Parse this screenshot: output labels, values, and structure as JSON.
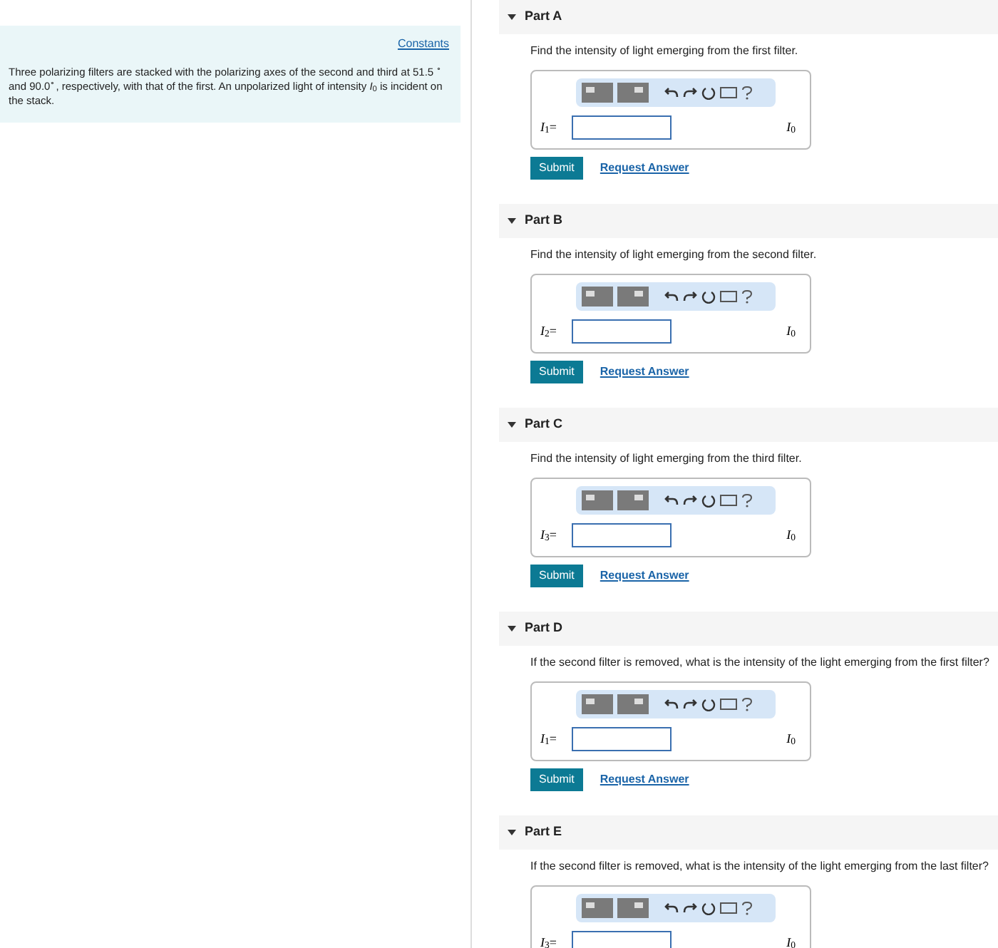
{
  "sidebar": {
    "link": "Constants",
    "text": "Three polarizing filters are stacked with the polarizing axes of the second and third at 51.5 $^{∘}$ and 90.0$^{∘}$, respectively, with that of the first. An unpolarized light of intensity *I*$_{0}$ is incident on the stack."
  },
  "parts": [
    {
      "title": "Part A",
      "expanded": true,
      "question": "Find the intensity of light emerging from the first filter.",
      "label": "*I*$_{1}$=",
      "unit": "*I*$_{0}$",
      "submit": "Submit",
      "request": "Request Answer"
    },
    {
      "title": "Part B",
      "expanded": true,
      "question": "Find the intensity of light emerging from the second filter.",
      "label": "*I*$_{2}$=",
      "unit": "*I*$_{0}$",
      "submit": "Submit",
      "request": "Request Answer"
    },
    {
      "title": "Part C",
      "expanded": true,
      "question": "Find the intensity of light emerging from the third filter.",
      "label": "*I*$_{3}$=",
      "unit": "*I*$_{0}$",
      "submit": "Submit",
      "request": "Request Answer"
    },
    {
      "title": "Part D",
      "expanded": true,
      "question": "If the second filter is removed, what is the intensity of the light emerging from the first filter?",
      "label": "*I*$_{1}$=",
      "unit": "*I*$_{0}$",
      "submit": "Submit",
      "request": "Request Answer"
    },
    {
      "title": "Part E",
      "expanded": true,
      "question": "If the second filter is removed, what is the intensity of the light emerging from the last filter?",
      "label": "*I*$_{3}$=",
      "unit": "*I*$_{0}$"
    }
  ]
}
